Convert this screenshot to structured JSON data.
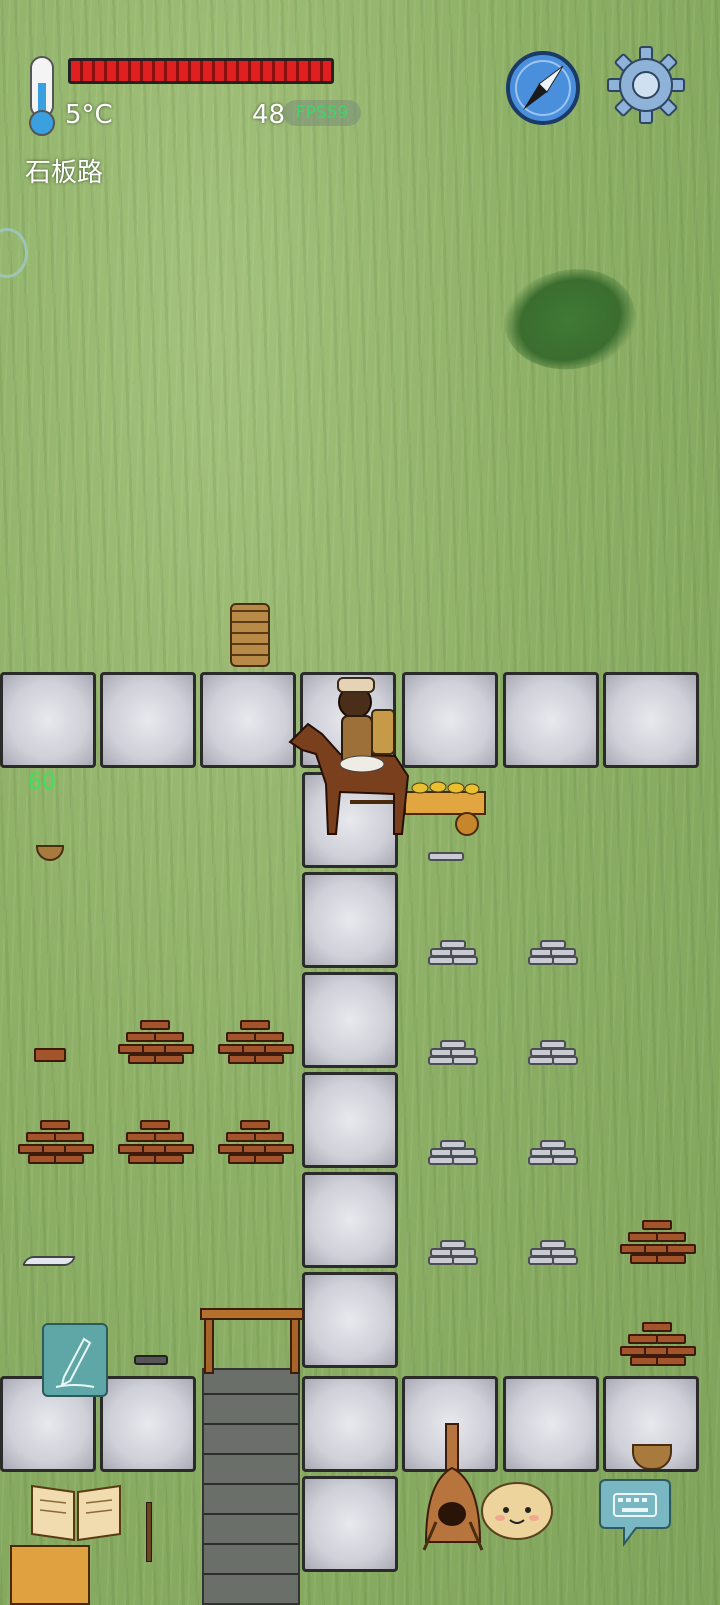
{
  "hud": {
    "temperature": "5°C",
    "location": "石板路",
    "health_percent": 100,
    "counter": "48",
    "fps_label": "FPS59",
    "floating_number": "60"
  },
  "colors": {
    "grass": "#8db066",
    "health": "#e02020",
    "fps_text": "#46d26a",
    "stone": "#cfd0d8"
  },
  "icons": {
    "thermometer": "thermometer-icon",
    "compass": "compass-icon",
    "settings": "gear-icon",
    "note": "pencil-note-icon",
    "recipe_book": "open-book-icon",
    "chat": "keyboard-chat-icon",
    "emote": "potato-face-icon"
  },
  "world": {
    "tile_type": "石板路",
    "objects": [
      "horse-cart",
      "player-character",
      "wooden-bucket",
      "brick-stack",
      "iron-ingot-stack",
      "basket",
      "kiln",
      "wooden-gate",
      "mossy-wall"
    ]
  }
}
